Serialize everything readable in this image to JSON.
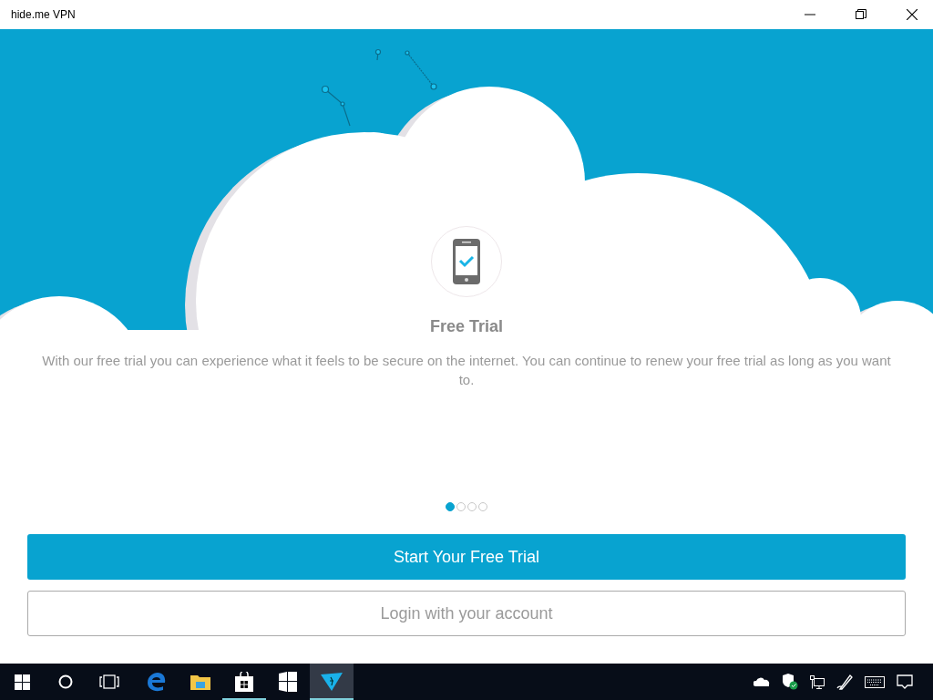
{
  "window": {
    "title": "hide.me VPN"
  },
  "slide": {
    "title": "Free Trial",
    "text": "With our free trial you can experience what it feels to be secure on the internet. You can continue to renew your free trial as long as you want to."
  },
  "pager": [
    {
      "selected": true
    },
    {
      "selected": false
    },
    {
      "selected": false
    },
    {
      "selected": false
    }
  ],
  "buttons": {
    "primary": "Start Your Free Trial",
    "secondary": "Login with your account"
  },
  "taskbar": {
    "apps": [
      {
        "kind": "edge",
        "running": false,
        "active": false
      },
      {
        "kind": "explorer",
        "running": false,
        "active": false
      },
      {
        "kind": "store",
        "running": true,
        "active": false
      },
      {
        "kind": "tiles",
        "running": false,
        "active": false
      },
      {
        "kind": "vpn",
        "running": true,
        "active": true
      }
    ]
  }
}
